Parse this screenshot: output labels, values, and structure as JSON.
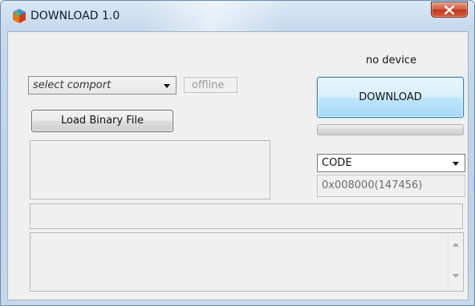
{
  "window": {
    "title": "DOWNLOAD 1.0",
    "app_icon": "app-cube-icon",
    "close_icon": "close-icon"
  },
  "port": {
    "selected": "select comport",
    "status": "offline"
  },
  "device": {
    "status": "no device"
  },
  "actions": {
    "download_label": "DOWNLOAD",
    "load_label": "Load Binary File"
  },
  "progress": {
    "value": 0
  },
  "memory": {
    "selected": "CODE",
    "address": "0x008000(147456)"
  },
  "colors": {
    "download_accent": "#3c7fb1",
    "close_red": "#c0381d",
    "progress_green": "#06b025"
  }
}
